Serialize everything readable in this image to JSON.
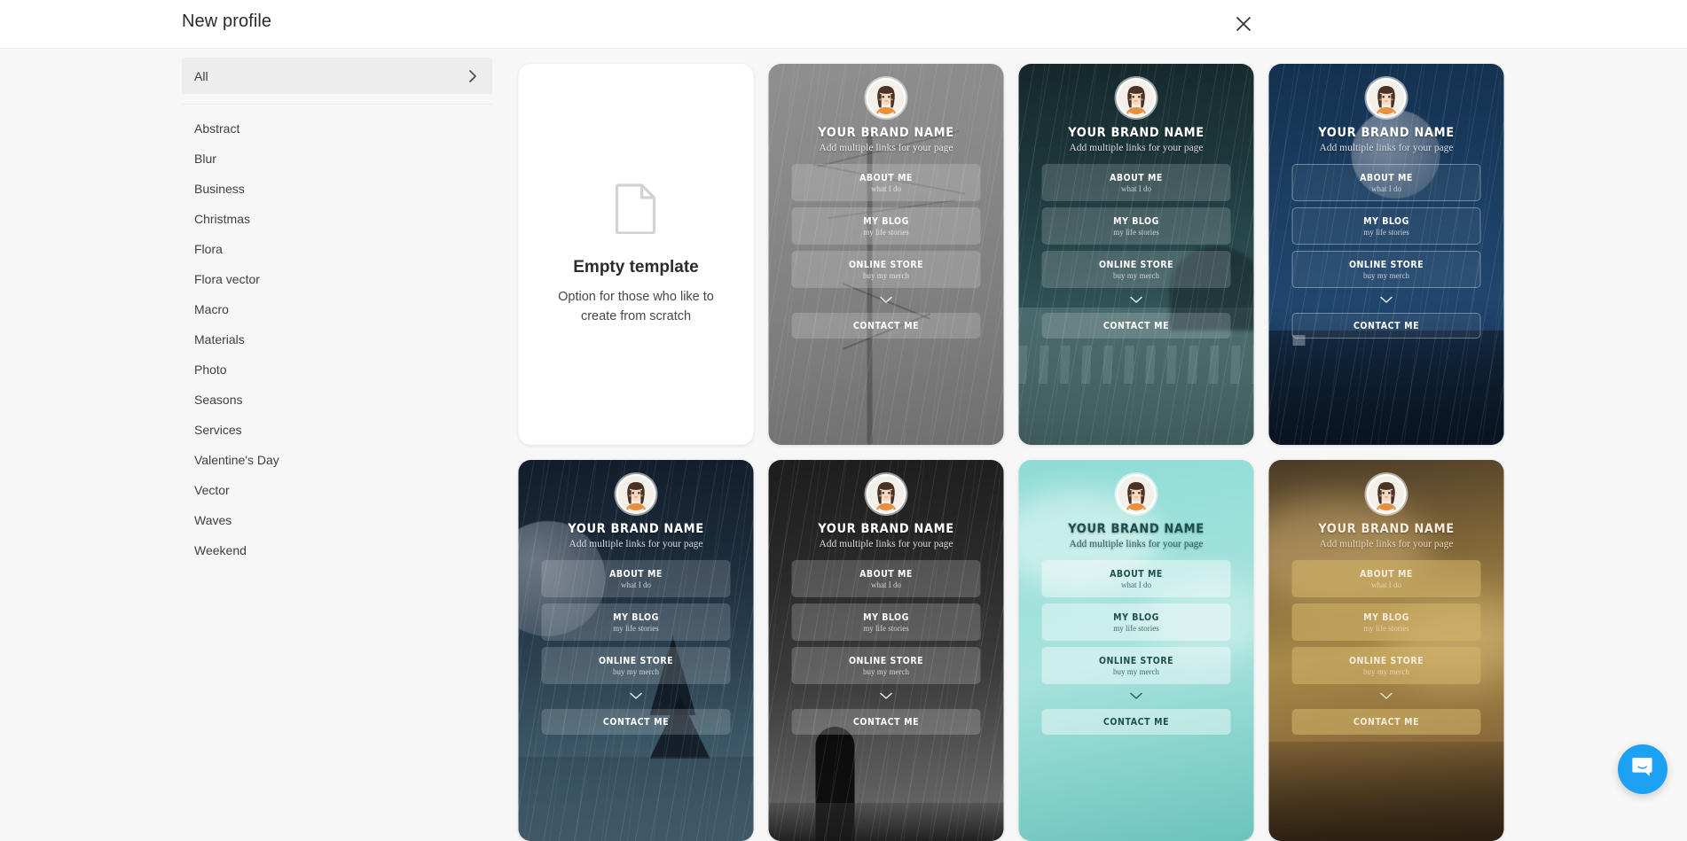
{
  "header": {
    "title": "New profile",
    "close_icon": "close-icon"
  },
  "sidebar": {
    "all": {
      "label": "All",
      "chevron_icon": "chevron-right-icon"
    },
    "categories": [
      {
        "label": "Abstract"
      },
      {
        "label": "Blur"
      },
      {
        "label": "Business"
      },
      {
        "label": "Christmas"
      },
      {
        "label": "Flora"
      },
      {
        "label": "Flora vector"
      },
      {
        "label": "Macro"
      },
      {
        "label": "Materials"
      },
      {
        "label": "Photo"
      },
      {
        "label": "Seasons"
      },
      {
        "label": "Services"
      },
      {
        "label": "Valentine's Day"
      },
      {
        "label": "Vector"
      },
      {
        "label": "Waves"
      },
      {
        "label": "Weekend"
      }
    ]
  },
  "empty_template": {
    "icon": "document-icon",
    "title": "Empty template",
    "subtitle": "Option for those who like to create from scratch"
  },
  "template_common": {
    "brand": "YOUR BRAND NAME",
    "tagline": "Add multiple links for your page",
    "avatar_icon": "avatar-woman-icon",
    "chevron_down_icon": "chevron-down-icon",
    "links": [
      {
        "title": "ABOUT ME",
        "subtitle": "what I do"
      },
      {
        "title": "MY BLOG",
        "subtitle": "my life stories"
      },
      {
        "title": "ONLINE STORE",
        "subtitle": "buy my merch"
      }
    ],
    "contact": "CONTACT ME"
  },
  "templates": [
    {
      "name": "grey-bare-tree",
      "bg": "linear-gradient(170deg,#8f8f8f 0%,#878787 35%,#7d7d7d 70%,#6f6f6f 100%)",
      "text_color": "#ffffff",
      "sub_color": "#e8e8e8",
      "button_bg": "rgba(255,255,255,0.18)",
      "button_border": "none",
      "scene": "bare-tree"
    },
    {
      "name": "dark-teal-ocean",
      "bg": "linear-gradient(175deg,#15282c 0%,#1d383c 30%,#2d4f52 58%,#3f6265 78%,#54787a 100%)",
      "text_color": "#ffffff",
      "sub_color": "#dcdcdc",
      "button_bg": "rgba(255,255,255,0.17)",
      "button_border": "none",
      "scene": "ocean"
    },
    {
      "name": "navy-moon-night",
      "bg": "linear-gradient(178deg,#14304f 0%,#1b3e62 35%,#20466e 62%,#16304c 85%,#0f2438 100%)",
      "text_color": "#ffffff",
      "sub_color": "#d7dde6",
      "button_bg": "rgba(255,255,255,0.06)",
      "button_border": "1px solid rgba(255,255,255,0.35)",
      "scene": "moon-night"
    },
    {
      "name": "blue-moon-forest",
      "bg": "linear-gradient(178deg,#121d2b 0%,#1c2c3c 28%,#2b4152 52%,#3a5666 74%,#4b6a78 100%)",
      "text_color": "#ffffff",
      "sub_color": "#d9dee3",
      "button_bg": "rgba(255,255,255,0.17)",
      "button_border": "none",
      "scene": "moon-forest"
    },
    {
      "name": "grey-rain-figure",
      "bg": "linear-gradient(176deg,#1d1d1d 0%,#2a2a2a 30%,#3b3b3b 56%,#565656 78%,#6e6e6e 100%)",
      "text_color": "#ffffff",
      "sub_color": "#dedede",
      "button_bg": "rgba(255,255,255,0.20)",
      "button_border": "none",
      "scene": "figure"
    },
    {
      "name": "mint-turquoise",
      "bg": "linear-gradient(170deg,#8fdcd6 0%,#9de0da 25%,#a8e3dd 52%,#86d2cc 78%,#6cc3be 100%)",
      "text_color": "#1d4f50",
      "sub_color": "#2c6261",
      "button_bg": "rgba(255,255,255,0.42)",
      "button_border": "none",
      "scene": "clouds-light"
    },
    {
      "name": "golden-brown",
      "bg": "linear-gradient(172deg,#4a3a27 0%,#7d6336 25%,#a78948 50%,#8a6a3a 75%,#4b3922 100%)",
      "text_color": "#f6ecdd",
      "sub_color": "#e8d8bd",
      "button_bg": "rgba(214,182,105,0.55)",
      "button_border": "none",
      "scene": "golden-clouds"
    }
  ],
  "chat": {
    "icon": "chat-bubble-icon",
    "color": "#1da1f2"
  }
}
